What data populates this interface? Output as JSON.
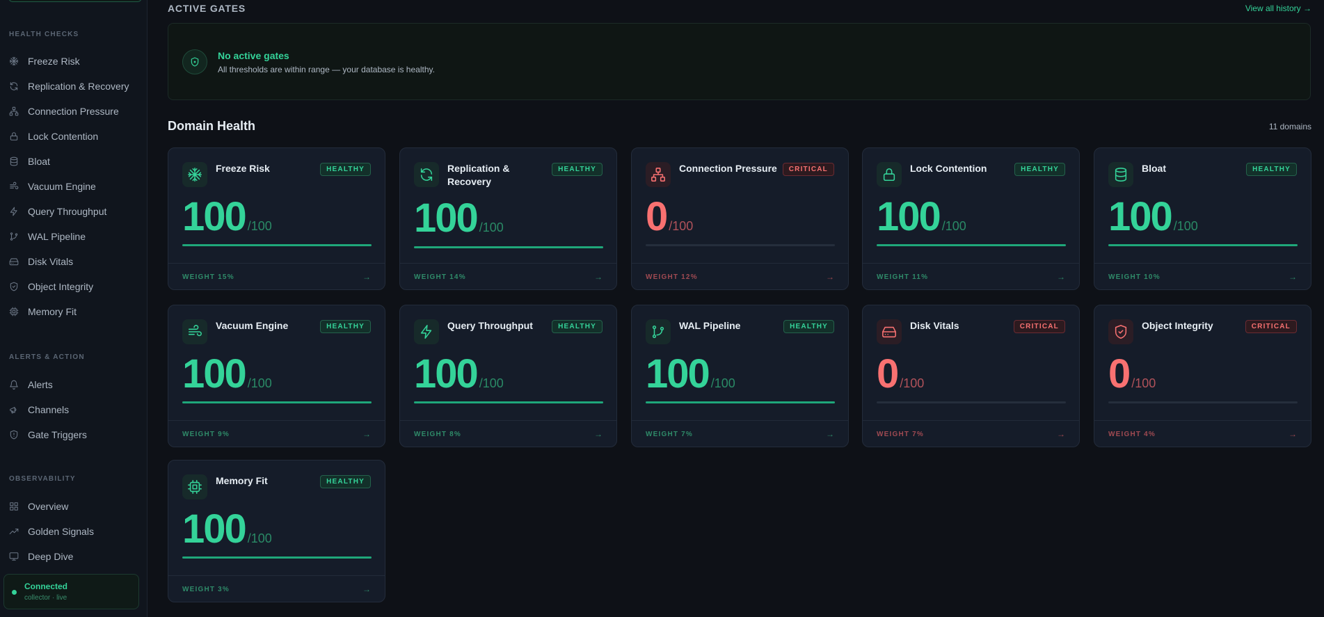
{
  "sidebar": {
    "sections": [
      {
        "label": "HEALTH CHECKS",
        "items": [
          {
            "label": "Freeze Risk",
            "icon": "snowflake-icon"
          },
          {
            "label": "Replication & Recovery",
            "icon": "refresh-icon"
          },
          {
            "label": "Connection Pressure",
            "icon": "network-icon"
          },
          {
            "label": "Lock Contention",
            "icon": "lock-icon"
          },
          {
            "label": "Bloat",
            "icon": "database-icon"
          },
          {
            "label": "Vacuum Engine",
            "icon": "wind-icon"
          },
          {
            "label": "Query Throughput",
            "icon": "bolt-icon"
          },
          {
            "label": "WAL Pipeline",
            "icon": "git-branch-icon"
          },
          {
            "label": "Disk Vitals",
            "icon": "hard-drive-icon"
          },
          {
            "label": "Object Integrity",
            "icon": "shield-check-icon"
          },
          {
            "label": "Memory Fit",
            "icon": "cpu-icon"
          }
        ]
      },
      {
        "label": "ALERTS & ACTION",
        "items": [
          {
            "label": "Alerts",
            "icon": "bell-icon"
          },
          {
            "label": "Channels",
            "icon": "megaphone-icon"
          },
          {
            "label": "Gate Triggers",
            "icon": "shield-alert-icon"
          }
        ]
      },
      {
        "label": "OBSERVABILITY",
        "items": [
          {
            "label": "Overview",
            "icon": "grid-icon"
          },
          {
            "label": "Golden Signals",
            "icon": "trending-up-icon"
          },
          {
            "label": "Deep Dive",
            "icon": "monitor-icon"
          }
        ]
      }
    ],
    "connection": {
      "status": "Connected",
      "detail": "collector · live",
      "color": "#34d399"
    }
  },
  "gates": {
    "title": "ACTIVE GATES",
    "view_all": "View all history →",
    "empty_title": "No active gates",
    "empty_sub": "All thresholds are within range — your database is healthy."
  },
  "domain_health": {
    "title": "Domain Health",
    "count": "11 domains",
    "cards": [
      {
        "name": "Freeze Risk",
        "status": "HEALTHY",
        "score": "100",
        "of": "/100",
        "weight": "WEIGHT 15%",
        "icon": "snowflake-icon",
        "level": 1.0
      },
      {
        "name": "Replication & Recovery",
        "status": "HEALTHY",
        "score": "100",
        "of": "/100",
        "weight": "WEIGHT 14%",
        "icon": "refresh-icon",
        "level": 1.0
      },
      {
        "name": "Connection Pressure",
        "status": "CRITICAL",
        "score": "0",
        "of": "/100",
        "weight": "WEIGHT 12%",
        "icon": "network-icon",
        "level": 0
      },
      {
        "name": "Lock Contention",
        "status": "HEALTHY",
        "score": "100",
        "of": "/100",
        "weight": "WEIGHT 11%",
        "icon": "lock-icon",
        "level": 1.0
      },
      {
        "name": "Bloat",
        "status": "HEALTHY",
        "score": "100",
        "of": "/100",
        "weight": "WEIGHT 10%",
        "icon": "database-icon",
        "level": 1.0
      },
      {
        "name": "Vacuum Engine",
        "status": "HEALTHY",
        "score": "100",
        "of": "/100",
        "weight": "WEIGHT 9%",
        "icon": "wind-icon",
        "level": 1.0
      },
      {
        "name": "Query Throughput",
        "status": "HEALTHY",
        "score": "100",
        "of": "/100",
        "weight": "WEIGHT 8%",
        "icon": "bolt-icon",
        "level": 1.0
      },
      {
        "name": "WAL Pipeline",
        "status": "HEALTHY",
        "score": "100",
        "of": "/100",
        "weight": "WEIGHT 7%",
        "icon": "git-branch-icon",
        "level": 1.0
      },
      {
        "name": "Disk Vitals",
        "status": "CRITICAL",
        "score": "0",
        "of": "/100",
        "weight": "WEIGHT 7%",
        "icon": "hard-drive-icon",
        "level": 0
      },
      {
        "name": "Object Integrity",
        "status": "CRITICAL",
        "score": "0",
        "of": "/100",
        "weight": "WEIGHT 4%",
        "icon": "shield-check-icon",
        "level": 0
      },
      {
        "name": "Memory Fit",
        "status": "HEALTHY",
        "score": "100",
        "of": "/100",
        "weight": "WEIGHT 3%",
        "icon": "cpu-icon",
        "level": 1.0
      }
    ]
  },
  "colors": {
    "healthy": "#34d399",
    "critical": "#f87171",
    "background": "#0e1117",
    "card": "#151c29"
  }
}
